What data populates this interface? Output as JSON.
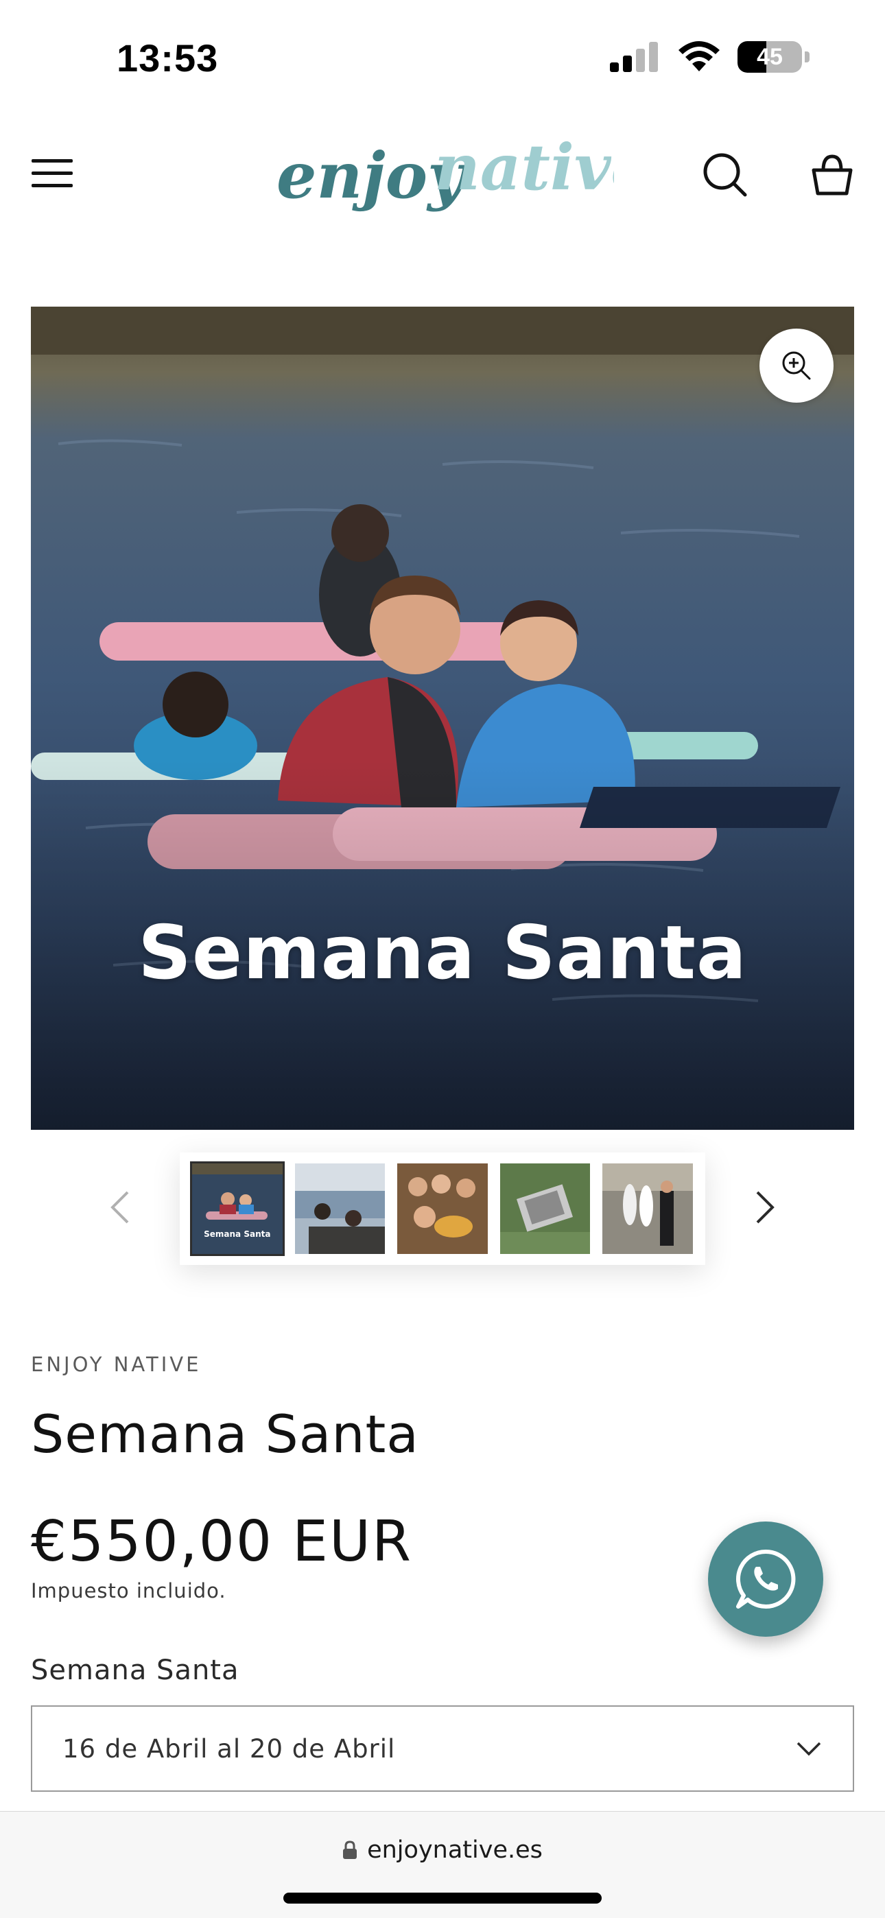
{
  "status_bar": {
    "time": "13:53",
    "battery_level": "45",
    "battery_percent": 45,
    "icons": [
      "signal-icon",
      "wifi-icon",
      "battery-icon"
    ]
  },
  "header": {
    "logo_text_primary": "enjoy",
    "logo_text_secondary": "native",
    "icons": [
      "hamburger-menu-icon",
      "search-icon",
      "cart-basket-icon"
    ]
  },
  "hero": {
    "overlay_title": "Semana Santa",
    "zoom_icon": "zoom-in-icon"
  },
  "thumbnails": {
    "count": 5,
    "active_index": 0,
    "first_caption": "Semana Santa",
    "icons": [
      "chevron-left-icon",
      "chevron-right-icon"
    ]
  },
  "product": {
    "vendor": "ENJOY NATIVE",
    "title": "Semana Santa",
    "price": "€550,00 EUR",
    "tax_note": "Impuesto incluido.",
    "variant_label": "Semana Santa",
    "variant_selected": "16 de Abril al 20 de Abril"
  },
  "whatsapp": {
    "icon": "whatsapp-icon"
  },
  "browser": {
    "url": "enjoynative.es",
    "lock_icon": "lock-icon"
  },
  "colors": {
    "brand_teal": "#4a8a8e",
    "logo_dark": "#3f7c82",
    "logo_light": "#9fcdd0"
  }
}
